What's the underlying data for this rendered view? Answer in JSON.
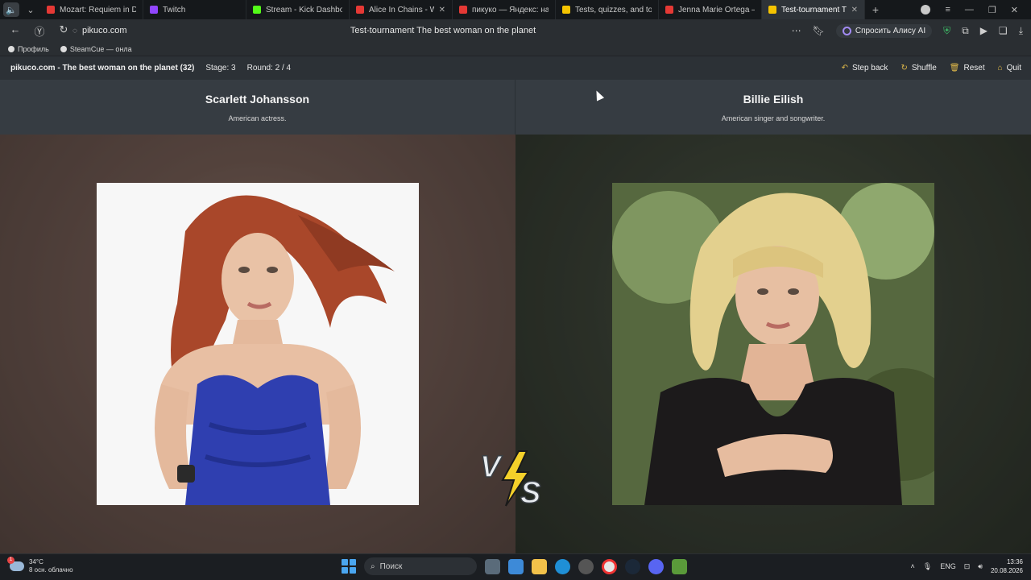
{
  "browser": {
    "tabs": [
      {
        "title": "Mozart: Requiem in D Mi",
        "favicon_color": "#e53935",
        "close": ""
      },
      {
        "title": "Twitch",
        "favicon_color": "#9146ff",
        "close": ""
      },
      {
        "title": "Stream - Kick Dashboard",
        "favicon_color": "#53fc18",
        "close": ""
      },
      {
        "title": "Alice In Chains - W",
        "favicon_color": "#e53935",
        "close": "✕"
      },
      {
        "title": "пикуко — Яндекс: нашл",
        "favicon_color": "#e53935",
        "close": ""
      },
      {
        "title": "Tests, quizzes, and tourn",
        "favicon_color": "#f5c400",
        "close": ""
      },
      {
        "title": "Jenna Marie Ortega — Ян",
        "favicon_color": "#e53935",
        "close": ""
      },
      {
        "title": "Test-tournament The b",
        "favicon_color": "#f5c400",
        "close": "✕"
      }
    ],
    "url": "pikuco.com",
    "page_title": "Test-tournament The best woman on the planet",
    "alice_label": "Спросить Алису AI",
    "bookmarks": [
      {
        "label": "Профиль"
      },
      {
        "label": "SteamCue — онла"
      }
    ]
  },
  "site": {
    "title": "pikuco.com - The best woman on the planet (32)",
    "stage": "Stage: 3",
    "round": "Round: 2 / 4",
    "actions": {
      "step_back": "Step back",
      "shuffle": "Shuffle",
      "reset": "Reset",
      "quit": "Quit"
    },
    "accent_color": "#e0b94a"
  },
  "contestants": {
    "left": {
      "name": "Scarlett Johansson",
      "description": "American actress."
    },
    "right": {
      "name": "Billie Eilish",
      "description": "American singer and songwriter."
    }
  },
  "taskbar": {
    "weather_temp": "34°C",
    "weather_desc": "8 осн. облачно",
    "weather_badge": "1",
    "search_label": "Поиск",
    "lang": "ENG",
    "time": "13:36",
    "date": "20.08.2026"
  }
}
